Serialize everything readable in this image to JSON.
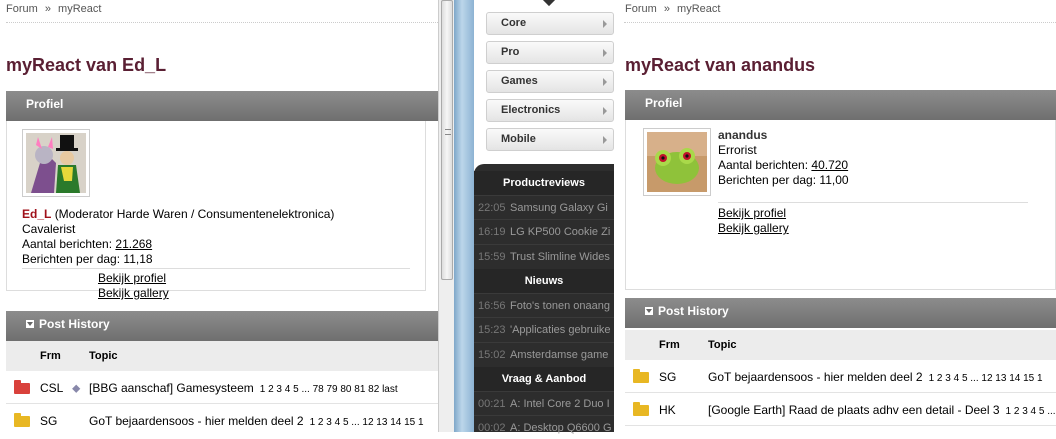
{
  "left": {
    "breadcrumb": {
      "forum": "Forum",
      "sep": "»",
      "page": "myReact"
    },
    "title": "myReact van Ed_L",
    "profile": {
      "header": "Profiel",
      "username": "Ed_L",
      "role": "(Moderator Harde Waren / Consumentenelektronica)",
      "rank": "Cavalerist",
      "posts_label": "Aantal berichten:",
      "posts_value": "21.268",
      "perday_label": "Berichten per dag:",
      "perday_value": "11,18",
      "view_profile": "Bekijk profiel",
      "view_gallery": "Bekijk gallery"
    },
    "history": {
      "header": "Post History",
      "col_frm": "Frm",
      "col_topic": "Topic",
      "rows": [
        {
          "frm": "CSL",
          "topic": "[BBG aanschaf] Gamesysteem",
          "pages": "1 2 3 4 5 ... 78 79 80 81 82 last",
          "folder_color": "#d9413b"
        },
        {
          "frm": "SG",
          "topic": "GoT bejaardensoos - hier melden deel 2",
          "pages": "1 2 3 4 5 ... 12 13 14 15 1",
          "folder_color": "#e8b723"
        }
      ]
    }
  },
  "middle": {
    "menu": [
      "Core",
      "Pro",
      "Games",
      "Electronics",
      "Mobile"
    ],
    "sections": [
      {
        "title": "Productreviews",
        "items": [
          {
            "time": "22:05",
            "text": "Samsung Galaxy Gi"
          },
          {
            "time": "16:19",
            "text": "LG KP500 Cookie Zi"
          },
          {
            "time": "15:59",
            "text": "Trust Slimline Wides"
          }
        ]
      },
      {
        "title": "Nieuws",
        "items": [
          {
            "time": "16:56",
            "text": "Foto's tonen onaang"
          },
          {
            "time": "15:23",
            "text": "'Applicaties gebruike"
          },
          {
            "time": "15:02",
            "text": "Amsterdamse game"
          }
        ]
      },
      {
        "title": "Vraag & Aanbod",
        "items": [
          {
            "time": "00:21",
            "text": "A: Intel Core 2 Duo I"
          },
          {
            "time": "00:02",
            "text": "A: Desktop Q6600 G"
          }
        ]
      }
    ]
  },
  "right": {
    "breadcrumb": {
      "forum": "Forum",
      "sep": "»",
      "page": "myReact"
    },
    "title": "myReact van anandus",
    "profile": {
      "header": "Profiel",
      "username": "anandus",
      "rank": "Errorist",
      "posts_label": "Aantal berichten:",
      "posts_value": "40.720",
      "perday_label": "Berichten per dag:",
      "perday_value": "11,00",
      "view_profile": "Bekijk profiel",
      "view_gallery": "Bekijk gallery"
    },
    "history": {
      "header": "Post History",
      "col_frm": "Frm",
      "col_topic": "Topic",
      "rows": [
        {
          "frm": "SG",
          "topic": "GoT bejaardensoos - hier melden deel 2",
          "pages": "1 2 3 4 5 ... 12 13 14 15 1",
          "folder_color": "#e8b723"
        },
        {
          "frm": "HK",
          "topic": "[Google Earth] Raad de plaats adhv een detail - Deel 3",
          "pages": "1 2 3 4 5 ...",
          "folder_color": "#e8b723"
        }
      ]
    }
  }
}
